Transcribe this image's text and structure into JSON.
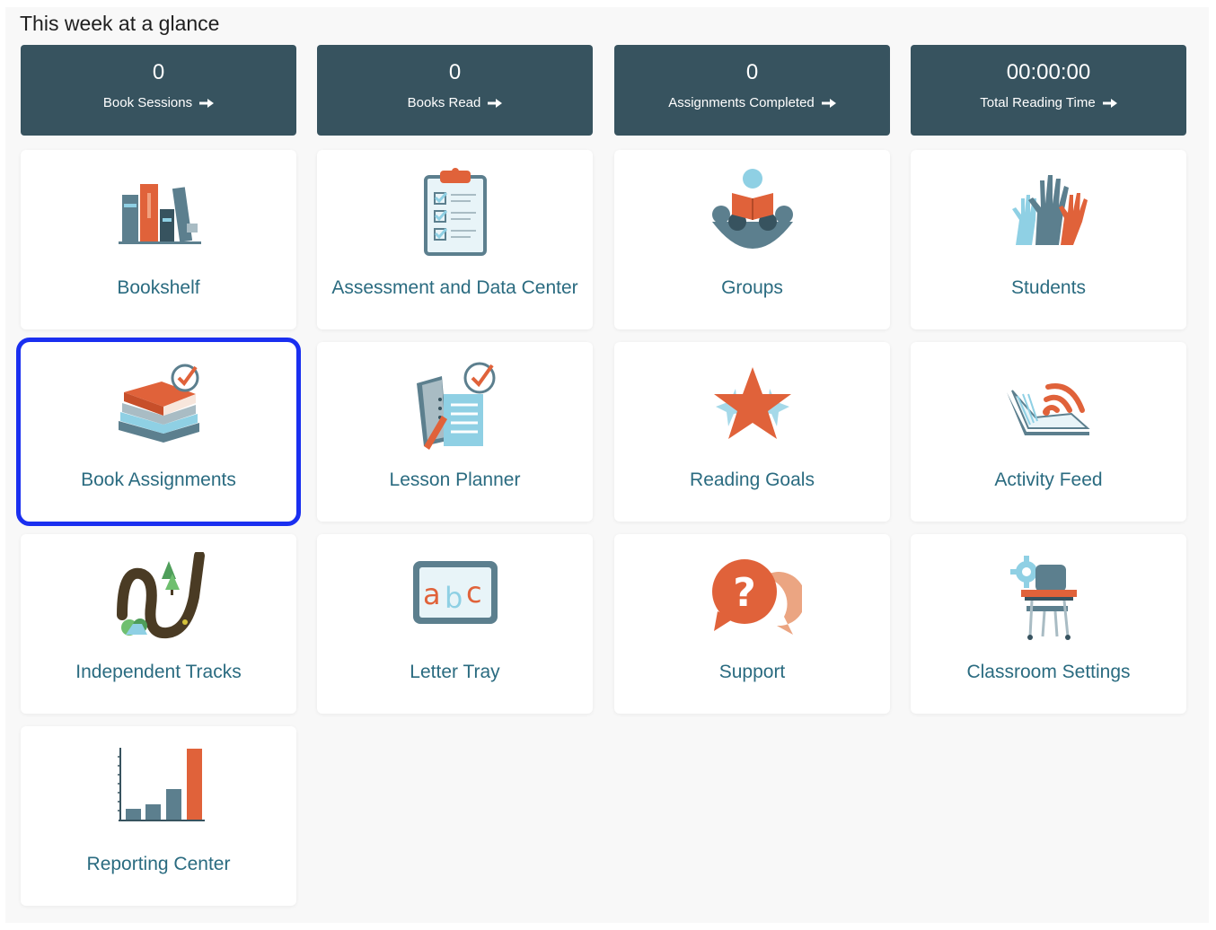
{
  "heading": "This week at a glance",
  "stats": [
    {
      "value": "0",
      "label": "Book Sessions"
    },
    {
      "value": "0",
      "label": "Books Read"
    },
    {
      "value": "0",
      "label": "Assignments Completed"
    },
    {
      "value": "00:00:00",
      "label": "Total Reading Time"
    }
  ],
  "tiles": [
    {
      "label": "Bookshelf",
      "icon": "bookshelf-icon"
    },
    {
      "label": "Assessment and Data Center",
      "icon": "clipboard-checklist-icon"
    },
    {
      "label": "Groups",
      "icon": "group-reading-icon"
    },
    {
      "label": "Students",
      "icon": "raised-hands-icon"
    },
    {
      "label": "Book Assignments",
      "icon": "book-stack-check-icon",
      "selected": true
    },
    {
      "label": "Lesson Planner",
      "icon": "lesson-planner-icon"
    },
    {
      "label": "Reading Goals",
      "icon": "star-icon"
    },
    {
      "label": "Activity Feed",
      "icon": "open-book-signal-icon"
    },
    {
      "label": "Independent Tracks",
      "icon": "winding-path-icon"
    },
    {
      "label": "Letter Tray",
      "icon": "abc-board-icon"
    },
    {
      "label": "Support",
      "icon": "question-bubble-icon"
    },
    {
      "label": "Classroom Settings",
      "icon": "desk-gear-icon"
    },
    {
      "label": "Reporting Center",
      "icon": "bar-chart-icon"
    }
  ],
  "colors": {
    "stat_bg": "#37535f",
    "tile_label": "#2a6b80",
    "accent_orange": "#e0623a",
    "slate": "#5c7f8e",
    "light_blue": "#8fd0e4",
    "selection_border": "#1a2ff0"
  }
}
